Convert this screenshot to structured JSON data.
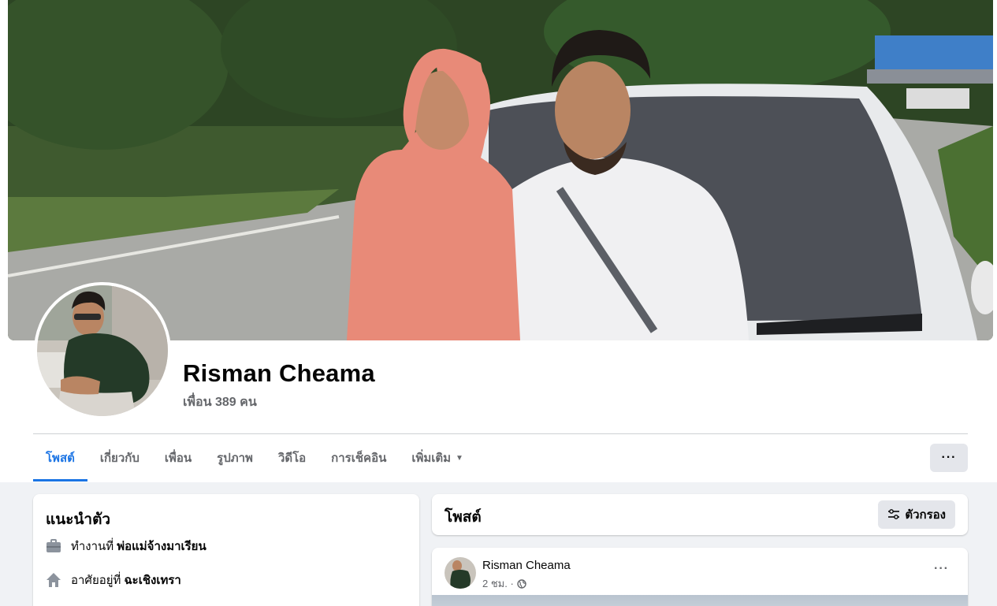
{
  "profile": {
    "name": "Risman Cheama",
    "friends": "เพื่อน 389 คน"
  },
  "tabs": [
    {
      "label": "โพสต์",
      "active": true
    },
    {
      "label": "เกี่ยวกับ",
      "active": false
    },
    {
      "label": "เพื่อน",
      "active": false
    },
    {
      "label": "รูปภาพ",
      "active": false
    },
    {
      "label": "วิดีโอ",
      "active": false
    },
    {
      "label": "การเช็คอิน",
      "active": false
    },
    {
      "label": "เพิ่มเติม",
      "active": false
    }
  ],
  "more_button": "···",
  "intro": {
    "title": "แนะนำตัว",
    "work_prefix": "ทำงานที่",
    "work_place": "พ่อแม่จ้างมาเรียน",
    "home_prefix": "อาศัยอยู่ที่",
    "home_place": "ฉะเชิงเทรา"
  },
  "posts": {
    "title": "โพสต์",
    "filter_label": "ตัวกรอง"
  },
  "post": {
    "author": "Risman Cheama",
    "time": "2 ชม. ·",
    "more": "···"
  },
  "colors": {
    "accent": "#1b74e4",
    "secondary_text": "#65676b",
    "background": "#f0f2f5",
    "button_gray": "#e4e6eb"
  }
}
